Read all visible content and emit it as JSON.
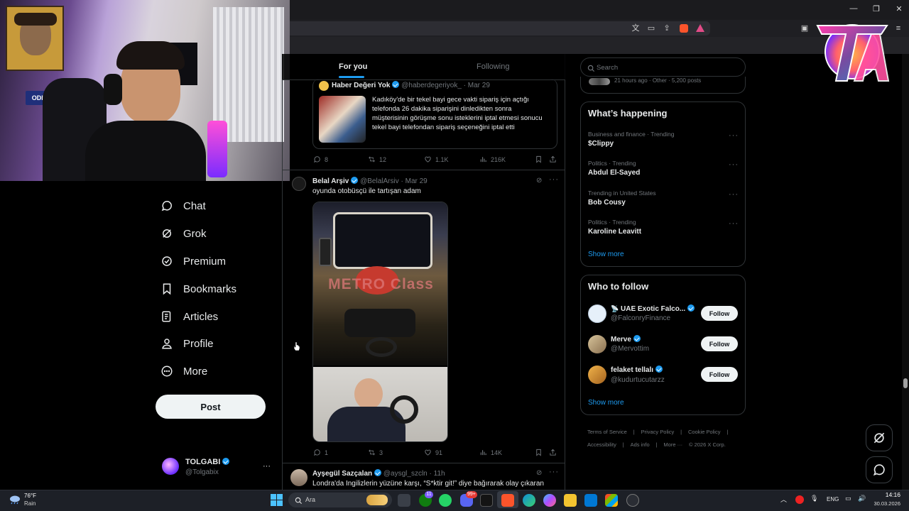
{
  "timeline": {
    "tabs": [
      "For you",
      "Following"
    ],
    "tweets": [
      {
        "name": "Haber Değeri Yok",
        "handle": "@haberdegeriyok_",
        "time": "· Mar 29",
        "text": "Kadıköy'de bir tekel bayi gece vakti sipariş için açtığı telefonda 26 dakika siparişini dinledikten sonra müşterisinin görüşme sonu isteklerini iptal etmesi sonucu tekel bayi telefondan sipariş seçeneğini iptal etti",
        "replies": "8",
        "reposts": "12",
        "likes": "1.1K",
        "views": "216K"
      },
      {
        "name": "Belal Arşiv",
        "handle": "@BelalArsiv",
        "time": "· Mar 29",
        "text": "oyunda otobüsçü ile tartışan adam",
        "replies": "1",
        "reposts": "3",
        "likes": "91",
        "views": "14K",
        "image_text": "METRO Class"
      },
      {
        "name": "Ayşegül Sazçalan",
        "handle": "@aysgl_szcln",
        "time": "· 11h",
        "text": "Londra'da İngilizlerin yüzüne karşı, “S*ktir git!” diye bağırarak olay çıkaran"
      }
    ]
  },
  "nav": {
    "items": [
      {
        "label": "Chat",
        "icon": "chat-icon"
      },
      {
        "label": "Grok",
        "icon": "grok-icon"
      },
      {
        "label": "Premium",
        "icon": "premium-icon"
      },
      {
        "label": "Bookmarks",
        "icon": "bookmark-icon"
      },
      {
        "label": "Articles",
        "icon": "articles-icon"
      },
      {
        "label": "Profile",
        "icon": "profile-icon"
      },
      {
        "label": "More",
        "icon": "more-icon"
      }
    ],
    "post_label": "Post",
    "account": {
      "name": "TOLGABI",
      "handle": "@Tolgabix",
      "more": "···"
    }
  },
  "right": {
    "search_placeholder": "Search",
    "partial_line": "21 hours ago · Other · 5,200 posts",
    "happening_title": "What’s happening",
    "trends": [
      {
        "context": "Business and finance · Trending",
        "name": "$Clippy"
      },
      {
        "context": "Politics · Trending",
        "name": "Abdul El-Sayed"
      },
      {
        "context": "Trending in United States",
        "name": "Bob Cousy"
      },
      {
        "context": "Politics · Trending",
        "name": "Karoline Leavitt"
      }
    ],
    "show_more": "Show more",
    "who_to_follow_title": "Who to follow",
    "who_to_follow": [
      {
        "name": "UAE Exotic Falco...",
        "handle": "@FalconryFinance"
      },
      {
        "name": "Merve",
        "handle": "@Mervottim"
      },
      {
        "name": "felaket tellalı",
        "handle": "@kudurtucutarzz"
      }
    ],
    "follow_label": "Follow",
    "footer": [
      "Terms of Service",
      "|",
      "Privacy Policy",
      "|",
      "Cookie Policy",
      "|",
      "Accessibility",
      "|",
      "Ads info",
      "|",
      "More ···",
      "© 2026 X Corp."
    ]
  },
  "webcam": {
    "sign_text": "ODIN"
  },
  "taskbar": {
    "weather_temp": "76°F",
    "weather_desc": "Rain",
    "search_placeholder": "Ara",
    "lang": "ENG",
    "time": "14:16",
    "date": "30.03.2026",
    "badges": [
      "11",
      "99+"
    ]
  },
  "colors": {
    "accent": "#1d9bf0",
    "background": "#000000",
    "border": "#2f3336",
    "muted": "#71767b"
  }
}
